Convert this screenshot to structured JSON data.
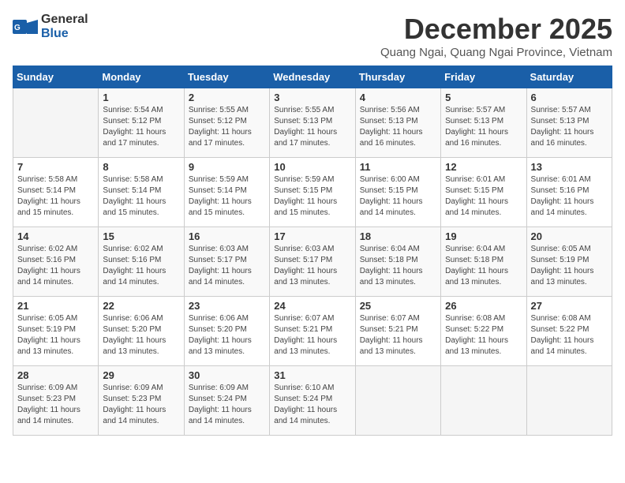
{
  "logo": {
    "general": "General",
    "blue": "Blue"
  },
  "title": "December 2025",
  "location": "Quang Ngai, Quang Ngai Province, Vietnam",
  "headers": [
    "Sunday",
    "Monday",
    "Tuesday",
    "Wednesday",
    "Thursday",
    "Friday",
    "Saturday"
  ],
  "weeks": [
    [
      {
        "day": "",
        "sunrise": "",
        "sunset": "",
        "daylight": ""
      },
      {
        "day": "1",
        "sunrise": "Sunrise: 5:54 AM",
        "sunset": "Sunset: 5:12 PM",
        "daylight": "Daylight: 11 hours and 17 minutes."
      },
      {
        "day": "2",
        "sunrise": "Sunrise: 5:55 AM",
        "sunset": "Sunset: 5:12 PM",
        "daylight": "Daylight: 11 hours and 17 minutes."
      },
      {
        "day": "3",
        "sunrise": "Sunrise: 5:55 AM",
        "sunset": "Sunset: 5:13 PM",
        "daylight": "Daylight: 11 hours and 17 minutes."
      },
      {
        "day": "4",
        "sunrise": "Sunrise: 5:56 AM",
        "sunset": "Sunset: 5:13 PM",
        "daylight": "Daylight: 11 hours and 16 minutes."
      },
      {
        "day": "5",
        "sunrise": "Sunrise: 5:57 AM",
        "sunset": "Sunset: 5:13 PM",
        "daylight": "Daylight: 11 hours and 16 minutes."
      },
      {
        "day": "6",
        "sunrise": "Sunrise: 5:57 AM",
        "sunset": "Sunset: 5:13 PM",
        "daylight": "Daylight: 11 hours and 16 minutes."
      }
    ],
    [
      {
        "day": "7",
        "sunrise": "Sunrise: 5:58 AM",
        "sunset": "Sunset: 5:14 PM",
        "daylight": "Daylight: 11 hours and 15 minutes."
      },
      {
        "day": "8",
        "sunrise": "Sunrise: 5:58 AM",
        "sunset": "Sunset: 5:14 PM",
        "daylight": "Daylight: 11 hours and 15 minutes."
      },
      {
        "day": "9",
        "sunrise": "Sunrise: 5:59 AM",
        "sunset": "Sunset: 5:14 PM",
        "daylight": "Daylight: 11 hours and 15 minutes."
      },
      {
        "day": "10",
        "sunrise": "Sunrise: 5:59 AM",
        "sunset": "Sunset: 5:15 PM",
        "daylight": "Daylight: 11 hours and 15 minutes."
      },
      {
        "day": "11",
        "sunrise": "Sunrise: 6:00 AM",
        "sunset": "Sunset: 5:15 PM",
        "daylight": "Daylight: 11 hours and 14 minutes."
      },
      {
        "day": "12",
        "sunrise": "Sunrise: 6:01 AM",
        "sunset": "Sunset: 5:15 PM",
        "daylight": "Daylight: 11 hours and 14 minutes."
      },
      {
        "day": "13",
        "sunrise": "Sunrise: 6:01 AM",
        "sunset": "Sunset: 5:16 PM",
        "daylight": "Daylight: 11 hours and 14 minutes."
      }
    ],
    [
      {
        "day": "14",
        "sunrise": "Sunrise: 6:02 AM",
        "sunset": "Sunset: 5:16 PM",
        "daylight": "Daylight: 11 hours and 14 minutes."
      },
      {
        "day": "15",
        "sunrise": "Sunrise: 6:02 AM",
        "sunset": "Sunset: 5:16 PM",
        "daylight": "Daylight: 11 hours and 14 minutes."
      },
      {
        "day": "16",
        "sunrise": "Sunrise: 6:03 AM",
        "sunset": "Sunset: 5:17 PM",
        "daylight": "Daylight: 11 hours and 14 minutes."
      },
      {
        "day": "17",
        "sunrise": "Sunrise: 6:03 AM",
        "sunset": "Sunset: 5:17 PM",
        "daylight": "Daylight: 11 hours and 13 minutes."
      },
      {
        "day": "18",
        "sunrise": "Sunrise: 6:04 AM",
        "sunset": "Sunset: 5:18 PM",
        "daylight": "Daylight: 11 hours and 13 minutes."
      },
      {
        "day": "19",
        "sunrise": "Sunrise: 6:04 AM",
        "sunset": "Sunset: 5:18 PM",
        "daylight": "Daylight: 11 hours and 13 minutes."
      },
      {
        "day": "20",
        "sunrise": "Sunrise: 6:05 AM",
        "sunset": "Sunset: 5:19 PM",
        "daylight": "Daylight: 11 hours and 13 minutes."
      }
    ],
    [
      {
        "day": "21",
        "sunrise": "Sunrise: 6:05 AM",
        "sunset": "Sunset: 5:19 PM",
        "daylight": "Daylight: 11 hours and 13 minutes."
      },
      {
        "day": "22",
        "sunrise": "Sunrise: 6:06 AM",
        "sunset": "Sunset: 5:20 PM",
        "daylight": "Daylight: 11 hours and 13 minutes."
      },
      {
        "day": "23",
        "sunrise": "Sunrise: 6:06 AM",
        "sunset": "Sunset: 5:20 PM",
        "daylight": "Daylight: 11 hours and 13 minutes."
      },
      {
        "day": "24",
        "sunrise": "Sunrise: 6:07 AM",
        "sunset": "Sunset: 5:21 PM",
        "daylight": "Daylight: 11 hours and 13 minutes."
      },
      {
        "day": "25",
        "sunrise": "Sunrise: 6:07 AM",
        "sunset": "Sunset: 5:21 PM",
        "daylight": "Daylight: 11 hours and 13 minutes."
      },
      {
        "day": "26",
        "sunrise": "Sunrise: 6:08 AM",
        "sunset": "Sunset: 5:22 PM",
        "daylight": "Daylight: 11 hours and 13 minutes."
      },
      {
        "day": "27",
        "sunrise": "Sunrise: 6:08 AM",
        "sunset": "Sunset: 5:22 PM",
        "daylight": "Daylight: 11 hours and 14 minutes."
      }
    ],
    [
      {
        "day": "28",
        "sunrise": "Sunrise: 6:09 AM",
        "sunset": "Sunset: 5:23 PM",
        "daylight": "Daylight: 11 hours and 14 minutes."
      },
      {
        "day": "29",
        "sunrise": "Sunrise: 6:09 AM",
        "sunset": "Sunset: 5:23 PM",
        "daylight": "Daylight: 11 hours and 14 minutes."
      },
      {
        "day": "30",
        "sunrise": "Sunrise: 6:09 AM",
        "sunset": "Sunset: 5:24 PM",
        "daylight": "Daylight: 11 hours and 14 minutes."
      },
      {
        "day": "31",
        "sunrise": "Sunrise: 6:10 AM",
        "sunset": "Sunset: 5:24 PM",
        "daylight": "Daylight: 11 hours and 14 minutes."
      },
      {
        "day": "",
        "sunrise": "",
        "sunset": "",
        "daylight": ""
      },
      {
        "day": "",
        "sunrise": "",
        "sunset": "",
        "daylight": ""
      },
      {
        "day": "",
        "sunrise": "",
        "sunset": "",
        "daylight": ""
      }
    ]
  ]
}
